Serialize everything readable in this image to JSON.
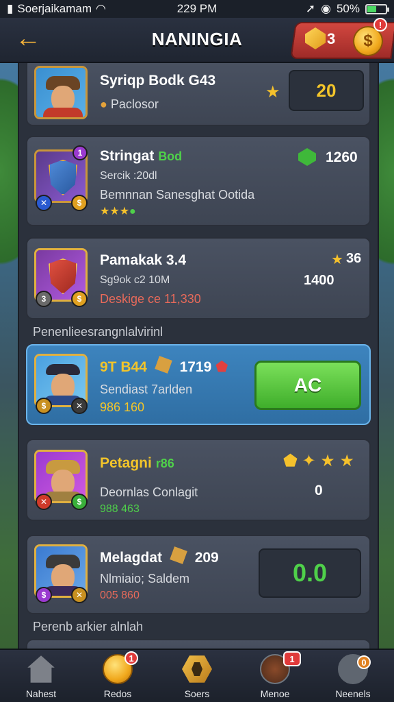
{
  "status_bar": {
    "carrier": "Soerjaikamam",
    "time": "229 PM",
    "battery_pct": "50%"
  },
  "header": {
    "title": "NANINGIA",
    "gem_count": "3",
    "coin_symbol": "$"
  },
  "cards": [
    {
      "name": "Syriqp Bodk G43",
      "line1": "Paclosor",
      "value": "20"
    },
    {
      "name": "Stringat",
      "name_tag": "Bod",
      "line1": "Sercik :20dl",
      "line2": "Bemnnan Sanesghat Ootida",
      "right_value": "1260"
    },
    {
      "name": "Pamakak 3.4",
      "line1": "Sg9ok c2 10M",
      "line2": "Deskige ce 11,330",
      "right_top": "36",
      "right_value": "1400"
    },
    {
      "name": "9T B44",
      "name_extra": "1719",
      "line1": "Sendiast 7arlden",
      "line2": "986 160",
      "button_label": "AC"
    },
    {
      "name": "Petagni",
      "name_tag": "r86",
      "line1": "Deornlas Conlagit",
      "line2": "988 463",
      "right_value": "0"
    },
    {
      "name": "Melagdat",
      "name_extra": "209",
      "line1": "Nlmiaio; Saldem",
      "line2": "005 860",
      "value": "0.0"
    }
  ],
  "section_labels": {
    "first": "Penenlieesrangnlalvirinl",
    "second": "Perenb arkier alnlah"
  },
  "bottom_nav": [
    {
      "label": "Nahest"
    },
    {
      "label": "Redos",
      "badge": "1"
    },
    {
      "label": "Soers"
    },
    {
      "label": "Menoe",
      "badge": "1"
    },
    {
      "label": "Neenels",
      "badge": "0"
    }
  ],
  "colors": {
    "accent_gold": "#f3c52a",
    "highlight_blue": "#3d84be",
    "button_green": "#4fc235",
    "header_red": "#c23d37"
  }
}
